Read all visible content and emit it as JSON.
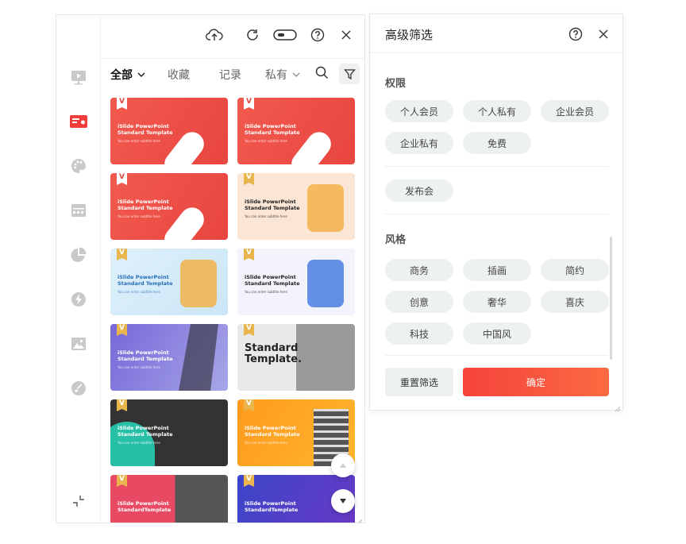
{
  "tabs": {
    "all": "全部",
    "favorites": "收藏",
    "history": "记录",
    "private": "私有"
  },
  "cards": [
    {
      "badge": "V",
      "title": "iSlide PowerPoint\nStandard Template",
      "sub": "You can enter subtitle here",
      "theme": "red"
    },
    {
      "badge": "V",
      "title": "iSlide PowerPoint\nStandard Template",
      "sub": "You can enter subtitle here",
      "theme": "red"
    },
    {
      "badge": "V",
      "title": "iSlide PowerPoint\nStandard Template",
      "sub": "You can enter subtitle here",
      "theme": "red"
    },
    {
      "badge": "V",
      "title": "iSlide PowerPoint\nStandard Template",
      "sub": "You can enter subtitle here",
      "theme": "peach"
    },
    {
      "badge": "V",
      "title": "iSlide PowerPoint\nStandard Template",
      "sub": "You can enter subtitle here",
      "theme": "sky"
    },
    {
      "badge": "V",
      "title": "iSlide PowerPoint\nStandard Template",
      "sub": "You can enter subtitle here",
      "theme": "white"
    },
    {
      "badge": "V",
      "title": "iSlide PowerPoint\nStandard Template",
      "sub": "You can enter subtitle here",
      "theme": "violet"
    },
    {
      "badge": "V",
      "title": "Standard\nTemplate.",
      "sub": "",
      "theme": "gray"
    },
    {
      "badge": "V",
      "title": "iSlide PowerPoint\nStandard Template",
      "sub": "You can enter subtitle here",
      "theme": "dark"
    },
    {
      "badge": "V",
      "title": "iSlide PowerPoint\nStandard Template",
      "sub": "You can enter subtitle here",
      "theme": "orange"
    },
    {
      "badge": "V",
      "title": "iSlide PowerPoint\nStandardTemplate",
      "sub": "",
      "theme": "crimson"
    },
    {
      "badge": "V",
      "title": "iSlide PowerPoint\nStandardTemplate",
      "sub": "",
      "theme": "blue"
    }
  ],
  "filter": {
    "title": "高级筛选",
    "permission_label": "权限",
    "permission_options": [
      "个人会员",
      "个人私有",
      "企业会员",
      "企业私有",
      "免费"
    ],
    "launch_option": "发布会",
    "style_label": "风格",
    "style_options": [
      "商务",
      "插画",
      "简约",
      "创意",
      "奢华",
      "喜庆",
      "科技",
      "中国风"
    ],
    "reset_label": "重置筛选",
    "confirm_label": "确定"
  },
  "colors": {
    "accent": "#f5433c",
    "accent_end": "#fb6a41",
    "badge_gold": "#e8b64c"
  }
}
